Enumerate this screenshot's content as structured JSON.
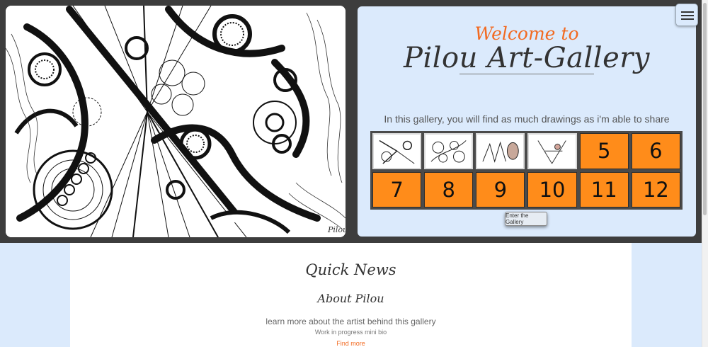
{
  "welcome": {
    "greeting": "Welcome to",
    "title": "Pilou Art-Gallery",
    "intro": "In this gallery, you will find as much drawings as i'm able to share"
  },
  "gallery": {
    "tiles": [
      {
        "type": "image",
        "label": "drawing 1"
      },
      {
        "type": "image",
        "label": "drawing 2"
      },
      {
        "type": "image",
        "label": "drawing 3"
      },
      {
        "type": "image",
        "label": "drawing 4"
      },
      {
        "type": "number",
        "label": "5"
      },
      {
        "type": "number",
        "label": "6"
      },
      {
        "type": "number",
        "label": "7"
      },
      {
        "type": "number",
        "label": "8"
      },
      {
        "type": "number",
        "label": "9"
      },
      {
        "type": "number",
        "label": "10"
      },
      {
        "type": "number",
        "label": "11"
      },
      {
        "type": "number",
        "label": "12"
      }
    ],
    "enter_button": "Enter the Gallery",
    "tile_color": "#ff8c1a"
  },
  "menu": {
    "icon": "hamburger-menu-icon"
  },
  "news": {
    "title": "Quick News",
    "about_title": "About Pilou",
    "about_prefix": "l",
    "about_link": "earn more",
    "about_suffix": " about the artist behind this gallery",
    "wip": "Work in progress mini bio",
    "find_more": "Find more"
  },
  "colors": {
    "accent": "#f26a21",
    "hero_bg": "#3d3d3d",
    "card_bg": "#dbeafc"
  }
}
